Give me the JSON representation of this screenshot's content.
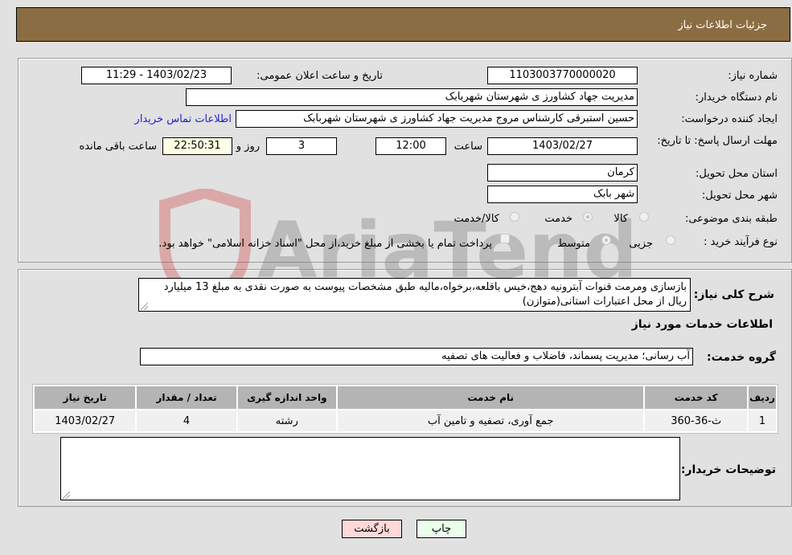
{
  "header": {
    "title": "جزئیات اطلاعات نیاز"
  },
  "form": {
    "need_number": {
      "label": "شماره نیاز:",
      "value": "1103003770000020"
    },
    "announce_datetime": {
      "label": "تاریخ و ساعت اعلان عمومی:",
      "value": "1403/02/23 - 11:29"
    },
    "buyer_org": {
      "label": "نام دستگاه خریدار:",
      "value": "مدیریت جهاد کشاورز ی شهرستان شهربابک"
    },
    "requester": {
      "label": "ایجاد کننده درخواست:",
      "value": "حسین استبرقی کارشناس مروج مدیریت جهاد کشاورز ی شهرستان شهربابک"
    },
    "contact_link": "اطلاعات تماس خریدار",
    "deadline": {
      "label": "مهلت ارسال پاسخ: تا تاریخ:",
      "date": "1403/02/27",
      "time_label": "ساعت",
      "time": "12:00",
      "days": "3",
      "days_label": "روز و",
      "remaining": "22:50:31",
      "remaining_label": "ساعت باقی مانده"
    },
    "province": {
      "label": "استان محل تحویل:",
      "value": "کرمان"
    },
    "city": {
      "label": "شهر محل تحویل:",
      "value": "شهر بابک"
    },
    "category": {
      "label": "طبقه بندی موضوعی:",
      "options": [
        "کالا",
        "خدمت",
        "کالا/خدمت"
      ],
      "selected": "خدمت"
    },
    "process": {
      "label": "نوع فرآیند خرید :",
      "options": [
        "جزیی",
        "متوسط"
      ],
      "selected": "متوسط",
      "payment_note": "پرداخت تمام یا بخشی از مبلغ خرید،از محل \"اسناد خزانه اسلامی\" خواهد بود."
    }
  },
  "details": {
    "description_label": "شرح کلی نیاز:",
    "description": "بازسازی ومرمت قنوات آبترونیه دهج،خیس باقلعه،برخواه،مالیه طبق مشخصات پیوست به صورت نقدی به مبلغ 13 میلیارد ریال از محل اعتبارات استانی(متوازن)",
    "services_title": "اطلاعات خدمات مورد نیاز",
    "service_group_label": "گروه خدمت:",
    "service_group": "آب رسانی؛ مدیریت پسماند، فاضلاب و فعالیت های تصفیه",
    "table": {
      "headers": [
        "ردیف",
        "کد خدمت",
        "نام خدمت",
        "واحد اندازه گیری",
        "تعداد / مقدار",
        "تاریخ نیاز"
      ],
      "rows": [
        [
          "1",
          "ث-36-360",
          "جمع آوری، تصفیه و تامین آب",
          "رشته",
          "4",
          "1403/02/27"
        ]
      ]
    },
    "buyer_notes_label": "توضیحات خریدار:",
    "buyer_notes": ""
  },
  "buttons": {
    "print": "چاپ",
    "back": "بازگشت"
  },
  "watermark": "AriaTender.neT"
}
